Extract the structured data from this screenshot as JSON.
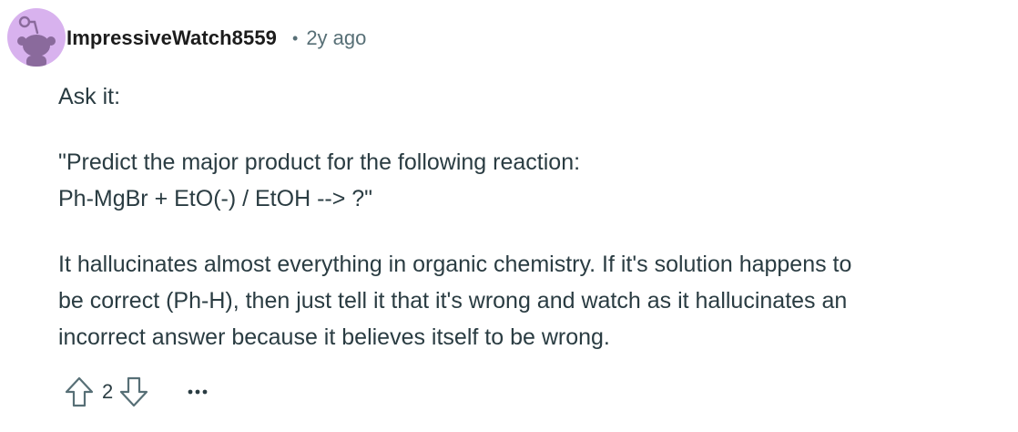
{
  "comment": {
    "username": "ImpressiveWatch8559",
    "separator": "•",
    "timestamp": "2y ago",
    "paragraphs": [
      {
        "lines": [
          "Ask it:"
        ]
      },
      {
        "lines": [
          "\"Predict the major product for the following reaction:",
          "Ph-MgBr + EtO(-) / EtOH --> ?\""
        ]
      },
      {
        "lines": [
          "It hallucinates almost everything in organic chemistry. If it's solution happens to",
          "be correct (Ph-H), then just tell it that it's wrong and watch as it hallucinates an",
          "incorrect answer because it believes itself to be wrong."
        ]
      }
    ],
    "score": "2"
  },
  "icons": {
    "avatar": "snoo-avatar",
    "upvote": "upvote-arrow-icon",
    "downvote": "downvote-arrow-icon",
    "more": "more-options-icon"
  },
  "colors": {
    "avatar_bg": "#d8b2ee",
    "avatar_fg": "#8a6a9c",
    "meta_text": "#576f76",
    "body_text": "#2a3c42"
  }
}
